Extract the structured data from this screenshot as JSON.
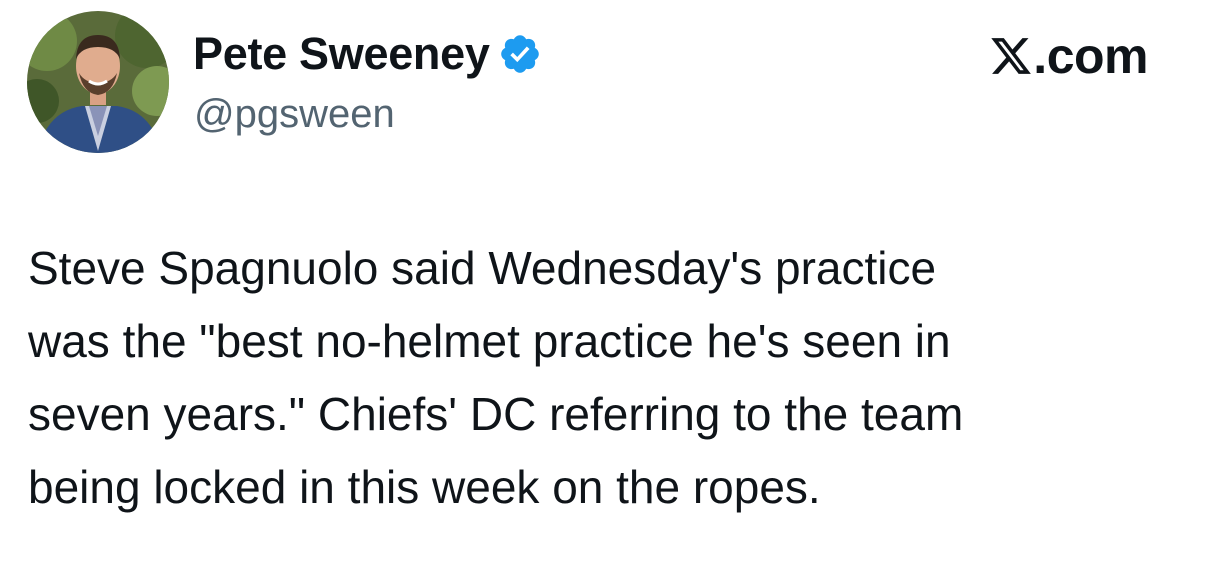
{
  "author": {
    "name": "Pete Sweeney",
    "handle": "@pgsween",
    "verified": true,
    "avatar_icon": "profile-photo"
  },
  "site": {
    "logo_icon": "x-logo-icon",
    "domain_suffix": ".com"
  },
  "tweet": {
    "text": "Steve Spagnuolo said Wednesday's practice\nwas the \"best no-helmet practice he's seen in\nseven years.\" Chiefs' DC referring to the team\nbeing locked in this week on the ropes."
  },
  "colors": {
    "text_primary": "#0f1419",
    "text_secondary": "#536471",
    "verified_blue": "#1d9bf0",
    "background": "#ffffff"
  }
}
